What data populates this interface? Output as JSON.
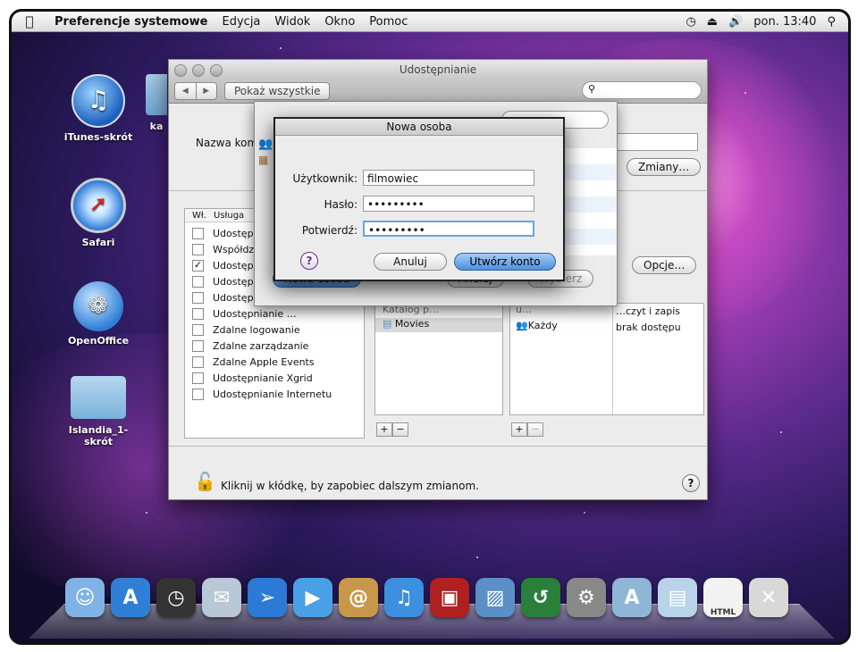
{
  "menubar": {
    "app": "Preferencje systemowe",
    "items": [
      "Edycja",
      "Widok",
      "Okno",
      "Pomoc"
    ],
    "clock": "pon. 13:40"
  },
  "desktop": {
    "icons": [
      {
        "label": "iTunes-skrót",
        "icon": "itunes-icon"
      },
      {
        "label": "ka",
        "icon": "folder-icon"
      },
      {
        "label": "Safari",
        "icon": "safari-icon"
      },
      {
        "label": "OpenOffice",
        "icon": "openoffice-icon"
      },
      {
        "label": "Islandia_1-\nskrót",
        "icon": "folder-icon"
      }
    ]
  },
  "window": {
    "title": "Udostępnianie",
    "show_all": "Pokaż wszystkie",
    "computer_name_label": "Nazwa kompu",
    "change_button": "Zmiany…",
    "options_button": "Opcje…",
    "services_header": {
      "on": "Wł.",
      "service": "Usługa"
    },
    "services": [
      {
        "label": "Udostępnia",
        "checked": false
      },
      {
        "label": "Współdziel",
        "checked": false
      },
      {
        "label": "Udostępnia",
        "checked": true
      },
      {
        "label": "Udostępnia",
        "checked": false
      },
      {
        "label": "Udostępnia",
        "checked": false
      },
      {
        "label": "Udostępnianie …",
        "checked": false
      },
      {
        "label": "Zdalne logowanie",
        "checked": false
      },
      {
        "label": "Zdalne zarządzanie",
        "checked": false
      },
      {
        "label": "Zdalne Apple Events",
        "checked": false
      },
      {
        "label": "Udostępnianie Xgrid",
        "checked": false
      },
      {
        "label": "Udostępnianie Internetu",
        "checked": false
      }
    ],
    "folders": [
      "Katalog p…",
      "Movies"
    ],
    "users": [
      "u…",
      "Każdy"
    ],
    "permissions": [
      "…czyt i zapis",
      "brak dostępu"
    ],
    "plus": "+",
    "minus": "−",
    "lock_text": "Kliknij w kłódkę, by zapobiec dalszym zmianom.",
    "help": "?"
  },
  "sheet": {
    "new_person_button": "Nowa osoba",
    "cancel_button": "Anuluj",
    "choose_button": "Wybierz"
  },
  "dialog": {
    "title": "Nowa osoba",
    "username_label": "Użytkownik:",
    "username_value": "filmowiec",
    "password_label": "Hasło:",
    "password_value": "•••••••••",
    "confirm_label": "Potwierdź:",
    "confirm_value": "•••••••••",
    "help": "?",
    "cancel": "Anuluj",
    "create": "Utwórz konto"
  },
  "dock": {
    "items": [
      "finder-icon",
      "app-store-icon",
      "dashboard-icon",
      "mail-stamp-icon",
      "safari-icon",
      "facetime-icon",
      "address-book-icon",
      "itunes-icon",
      "photo-booth-icon",
      "iphoto-icon",
      "time-machine-icon",
      "system-preferences-icon",
      "applications-folder-icon",
      "documents-folder-icon",
      "html-file-icon",
      "trash-icon"
    ],
    "html_label": "HTML"
  }
}
